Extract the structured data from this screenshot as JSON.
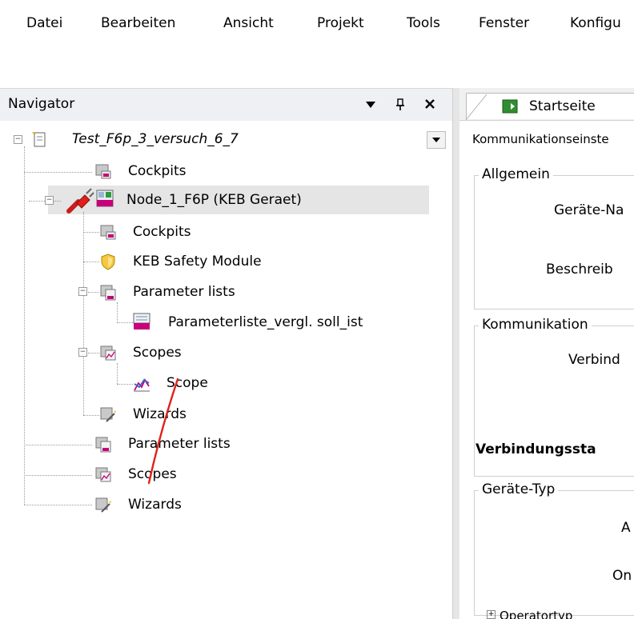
{
  "menu": [
    "Datei",
    "Bearbeiten",
    "Ansicht",
    "Projekt",
    "Tools",
    "Fenster",
    "Konfigu"
  ],
  "navigator": {
    "title": "Navigator",
    "buttons": {
      "dropdown": "▾",
      "pin": "P",
      "close": "✕"
    },
    "dropdown_glyph": "▼"
  },
  "tree": {
    "root": "Test_F6p_3_versuch_6_7",
    "cockpits1": "Cockpits",
    "node": "Node_1_F6P (KEB Geraet)",
    "cockpits2": "Cockpits",
    "safety": "KEB Safety Module",
    "paramlists1": "Parameter lists",
    "paramliste": "Parameterliste_vergl. soll_ist",
    "scopes1": "Scopes",
    "scope": "Scope",
    "wizards1": "Wizards",
    "paramlists2": "Parameter lists",
    "scopes2": "Scopes",
    "wizards2": "Wizards"
  },
  "tabs": {
    "start": "Startseite"
  },
  "panel": {
    "heading": "Kommunikationseinste",
    "group_allgemein": "Allgemein",
    "geraete_name": "Geräte-Na",
    "beschreibung": "Beschreib",
    "group_kommunikation": "Kommunikation",
    "verbindung": "Verbind",
    "verbindungsstatus": "Verbindungssta",
    "group_geraetetyp": "Geräte-Typ",
    "a_label": "A",
    "on_label": "On",
    "operatortyp": "Operatortyp"
  },
  "colors": {
    "accent_red": "#e0211b",
    "keb_magenta": "#c8007a"
  }
}
